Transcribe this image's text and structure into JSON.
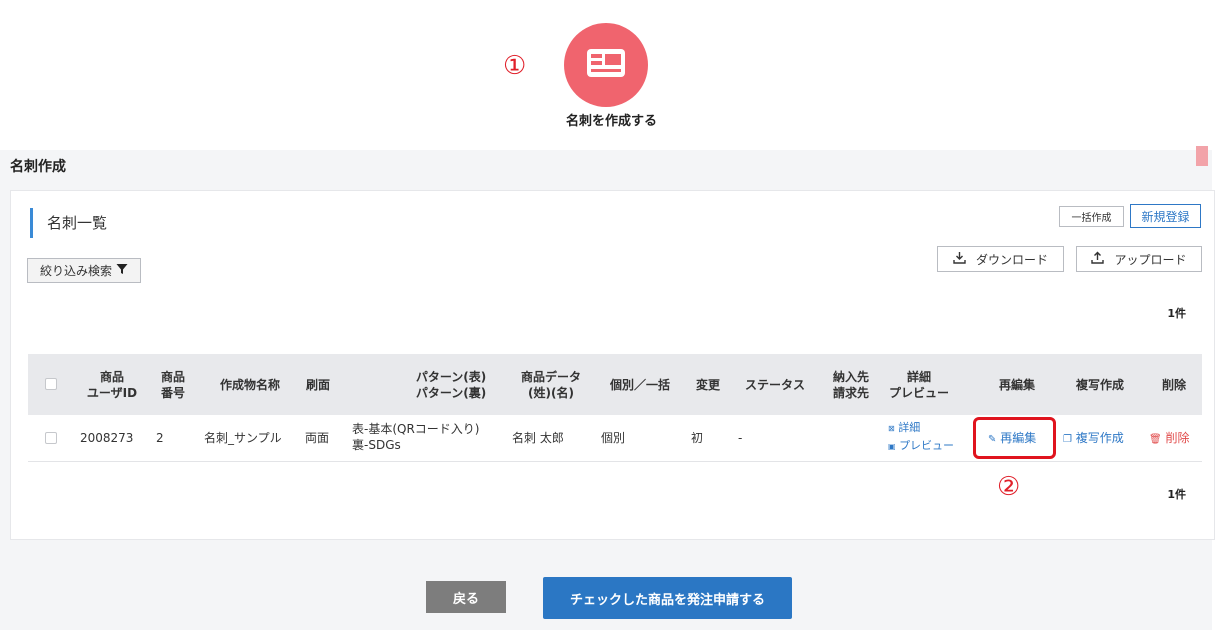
{
  "header": {
    "step1": "①",
    "icon": "business-card-icon",
    "title": "名刺を作成する"
  },
  "panel": {
    "title": "名刺作成"
  },
  "card": {
    "heading": "名刺一覧",
    "bulk_create": "一括作成",
    "new_register": "新規登録",
    "filter_search": "絞り込み検索",
    "download": "ダウンロード",
    "upload": "アップロード",
    "count_top": "1件",
    "count_bottom": "1件"
  },
  "table": {
    "headers": {
      "product_user_id": [
        "商品",
        "ユーザID"
      ],
      "product_no": [
        "商品",
        "番号"
      ],
      "work_name": "作成物名称",
      "print_side": "刷面",
      "pattern": [
        "パターン(表)",
        "パターン(裏)"
      ],
      "product_data": [
        "商品データ",
        "(姓)(名)"
      ],
      "individual_bulk": "個別／一括",
      "change": "変更",
      "status": "ステータス",
      "delivery": [
        "納入先",
        "請求先"
      ],
      "detail_preview": [
        "詳細",
        "プレビュー"
      ],
      "reedit": "再編集",
      "copy_create": "複写作成",
      "delete": "削除"
    },
    "rows": [
      {
        "user_id": "2008273",
        "product_no": "2",
        "work_name": "名刺_サンプル",
        "print_side": "両面",
        "pattern_front": "表-基本(QRコード入り)",
        "pattern_back": "裏-SDGs",
        "name": "名刺 太郎",
        "individual_bulk": "個別",
        "change": "初",
        "status": "-",
        "detail_link": "詳細",
        "preview_link": "プレビュー",
        "reedit_link": "再編集",
        "copy_link": "複写作成",
        "delete_link": "削除"
      }
    ]
  },
  "annotations": {
    "step2": "②"
  },
  "footer": {
    "back": "戻る",
    "submit": "チェックした商品を発注申請する"
  },
  "colors": {
    "accent_pink": "#f0646e",
    "link_blue": "#2e78c6",
    "primary_button": "#2b77c4",
    "highlight_red": "#e0141e",
    "delete_red": "#e14b4b"
  }
}
